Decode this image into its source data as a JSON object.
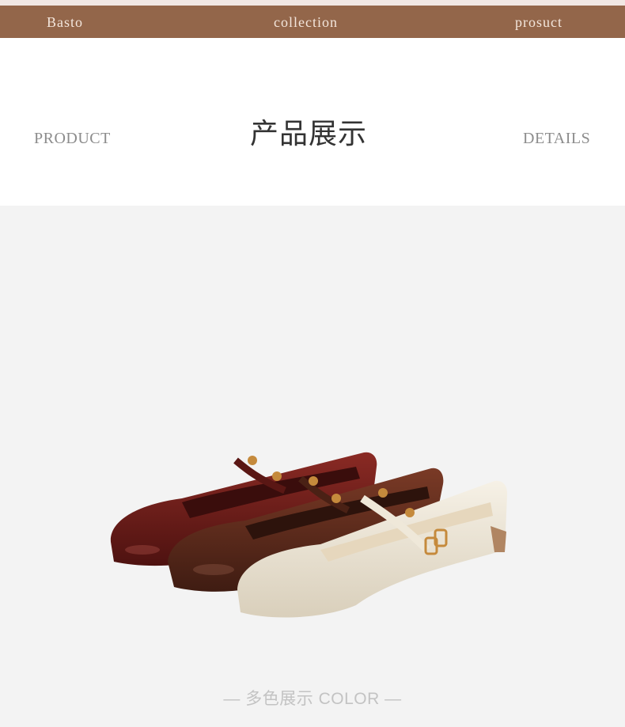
{
  "nav": {
    "left": "Basto",
    "center": "collection",
    "right": "prosuct"
  },
  "header": {
    "left_label": "PRODUCT",
    "title": "产品展示",
    "right_label": "DETAILS"
  },
  "product": {
    "caption": "— 多色展示 COLOR —",
    "colors": {
      "burgundy": "#6e1d1a",
      "brown": "#5b2a1d",
      "cream": "#ece4d3",
      "stud_gold": "#c58a3c"
    }
  },
  "theme": {
    "nav_bg": "#93664a",
    "top_strip": "#f1e7e3",
    "product_bg": "#f3f3f3"
  }
}
